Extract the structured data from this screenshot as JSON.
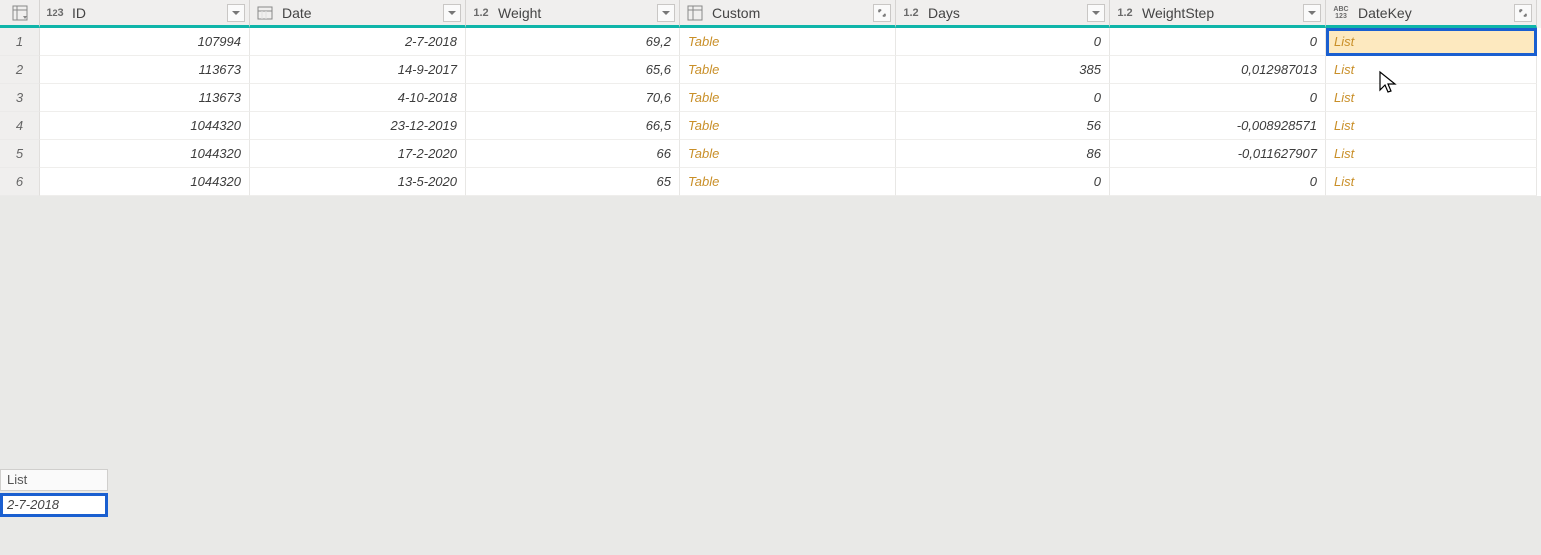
{
  "columns": [
    {
      "name": "ID",
      "type": "int",
      "control": "filter"
    },
    {
      "name": "Date",
      "type": "date",
      "control": "filter"
    },
    {
      "name": "Weight",
      "type": "dec",
      "control": "filter"
    },
    {
      "name": "Custom",
      "type": "table",
      "control": "expand"
    },
    {
      "name": "Days",
      "type": "dec",
      "control": "filter"
    },
    {
      "name": "WeightStep",
      "type": "dec",
      "control": "filter"
    },
    {
      "name": "DateKey",
      "type": "any",
      "control": "expand"
    }
  ],
  "rows": [
    {
      "n": "1",
      "ID": "107994",
      "Date": "2-7-2018",
      "Weight": "69,2",
      "Custom": "Table",
      "Days": "0",
      "WeightStep": "0",
      "DateKey": "List"
    },
    {
      "n": "2",
      "ID": "113673",
      "Date": "14-9-2017",
      "Weight": "65,6",
      "Custom": "Table",
      "Days": "385",
      "WeightStep": "0,012987013",
      "DateKey": "List"
    },
    {
      "n": "3",
      "ID": "113673",
      "Date": "4-10-2018",
      "Weight": "70,6",
      "Custom": "Table",
      "Days": "0",
      "WeightStep": "0",
      "DateKey": "List"
    },
    {
      "n": "4",
      "ID": "1044320",
      "Date": "23-12-2019",
      "Weight": "66,5",
      "Custom": "Table",
      "Days": "56",
      "WeightStep": "-0,008928571",
      "DateKey": "List"
    },
    {
      "n": "5",
      "ID": "1044320",
      "Date": "17-2-2020",
      "Weight": "66",
      "Custom": "Table",
      "Days": "86",
      "WeightStep": "-0,011627907",
      "DateKey": "List"
    },
    {
      "n": "6",
      "ID": "1044320",
      "Date": "13-5-2020",
      "Weight": "65",
      "Custom": "Table",
      "Days": "0",
      "WeightStep": "0",
      "DateKey": "List"
    }
  ],
  "selected": {
    "row": 0,
    "col": "DateKey"
  },
  "preview": {
    "title": "List",
    "value": "2-7-2018"
  }
}
